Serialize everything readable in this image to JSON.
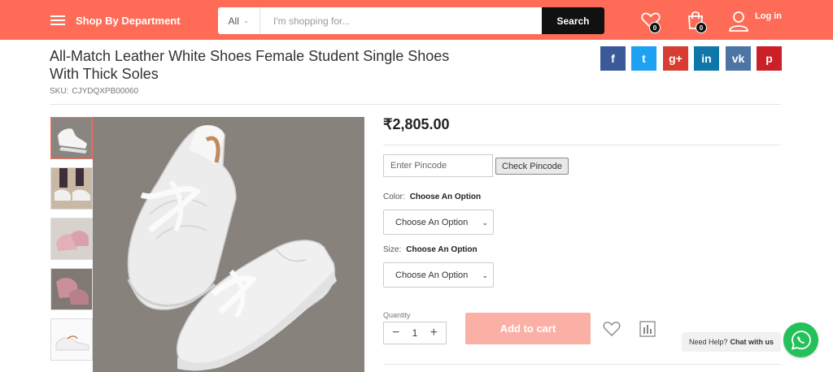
{
  "header": {
    "department_label": "Shop By Department",
    "search": {
      "category": "All",
      "placeholder": "I'm shopping for...",
      "button_label": "Search"
    },
    "wishlist_count": "0",
    "cart_count": "0",
    "login_label": "Log in"
  },
  "product": {
    "title": "All-Match Leather White Shoes Female Student Single Shoes With Thick Soles",
    "sku_label": "SKU:",
    "sku": "CJYDQXPB00060",
    "price": "₹2,805.00",
    "pincode_placeholder": "Enter Pincode",
    "check_pincode_label": "Check Pincode",
    "color_label": "Color:",
    "color_value": "Choose An Option",
    "color_select": "Choose An Option",
    "size_label": "Size:",
    "size_value": "Choose An Option",
    "size_select": "Choose An Option",
    "quantity_label": "Quantity",
    "quantity": "1",
    "add_to_cart_label": "Add to cart"
  },
  "share": {
    "buttons": [
      {
        "name": "facebook",
        "glyph": "f",
        "color": "#3b5998"
      },
      {
        "name": "twitter",
        "glyph": "t",
        "color": "#1da1f2"
      },
      {
        "name": "google-plus",
        "glyph": "g+",
        "color": "#d73d32"
      },
      {
        "name": "linkedin",
        "glyph": "in",
        "color": "#0e76a8"
      },
      {
        "name": "vk",
        "glyph": "vk",
        "color": "#4c75a3"
      },
      {
        "name": "pinterest",
        "glyph": "p",
        "color": "#cb2027"
      }
    ]
  },
  "chat": {
    "prefix": "Need Help?",
    "link": "Chat with us"
  },
  "colors": {
    "brand": "#fe6c57",
    "add_to_cart": "#fbb0a6",
    "whatsapp": "#24c05a"
  }
}
